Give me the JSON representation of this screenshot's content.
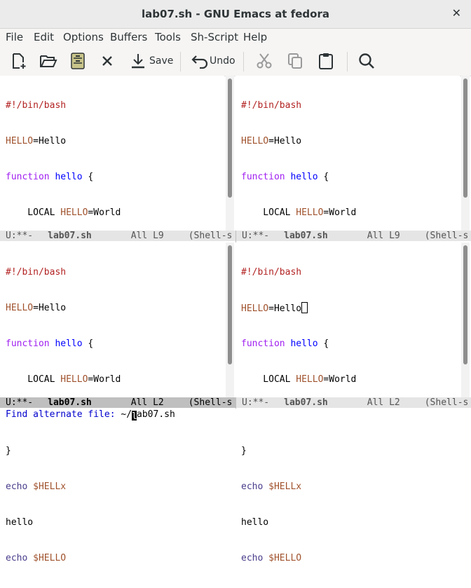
{
  "window": {
    "title": "lab07.sh - GNU Emacs at fedora",
    "close_glyph": "✕"
  },
  "menu": [
    "File",
    "Edit",
    "Options",
    "Buffers",
    "Tools",
    "Sh-Script",
    "Help"
  ],
  "toolbar": {
    "save_label": "Save",
    "undo_label": "Undo"
  },
  "panes": {
    "top_left": {
      "modeline_status": "U:**-",
      "buffer": "lab07.sh",
      "position": "All L9",
      "mode": "(Shell-s"
    },
    "top_right": {
      "modeline_status": "U:**-",
      "buffer": "lab07.sh",
      "position": "All L9",
      "mode": "(Shell-s"
    },
    "bottom_left": {
      "modeline_status": "U:**-",
      "buffer": "lab07.sh",
      "position": "All L2",
      "mode": "(Shell-s"
    },
    "bottom_right": {
      "modeline_status": "U:**-",
      "buffer": "lab07.sh",
      "position": "All L2",
      "mode": "(Shell-s"
    }
  },
  "code": {
    "shebang": "#!/bin/bash",
    "var_name": "HELLO",
    "var_value": "=Hello",
    "kw_function": "function",
    "fn_name": "hello",
    "brace_open": " {",
    "local_kw": "    LOCAL ",
    "local_value": "=World",
    "brace_close": "}",
    "echo": "echo",
    "var_ref_1": "$HELLx",
    "plain_line": "hello",
    "var_ref_2": "$HELLO"
  },
  "minibuffer": {
    "prompt": "Find alternate file: ",
    "value_prefix": "~/",
    "cursor_char": "l",
    "value_suffix": "ab07.sh"
  },
  "colors": {
    "keyword": "#a020f0",
    "function_name": "#0000ff",
    "comment": "#b22222",
    "variable": "#a0522d",
    "builtin": "#483d8b",
    "prompt": "#0000cd"
  }
}
